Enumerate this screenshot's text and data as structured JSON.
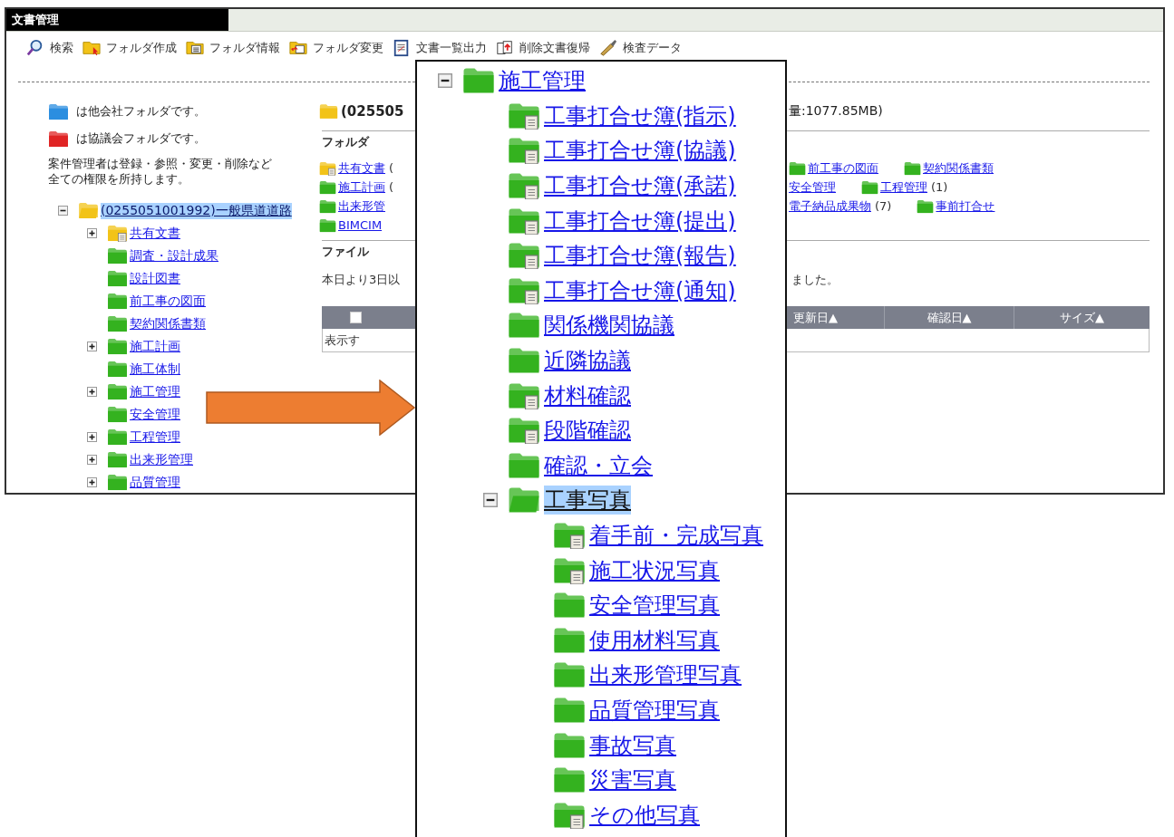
{
  "window": {
    "title": "文書管理"
  },
  "toolbar": [
    {
      "kind": "search",
      "label": "検索"
    },
    {
      "kind": "folder_new",
      "label": "フォルダ作成"
    },
    {
      "kind": "folder_info",
      "label": "フォルダ情報"
    },
    {
      "kind": "folder_change",
      "label": "フォルダ変更"
    },
    {
      "kind": "list_export",
      "label": "文書一覧出力"
    },
    {
      "kind": "restore",
      "label": "削除文書復帰"
    },
    {
      "kind": "inspect",
      "label": "検査データ"
    }
  ],
  "legend": [
    {
      "text": "は他会社フォルダです。",
      "color": "#2b8ee0"
    },
    {
      "text": "は協議会フォルダです。",
      "color": "#e02424"
    }
  ],
  "note": [
    "案件管理者は登録・参照・変更・削除など",
    "全ての権限を所持します。"
  ],
  "tree": {
    "label": "(0255051001992)一般県道道路",
    "kind": "open_yellow",
    "expanded": true,
    "selected": true,
    "children": [
      {
        "label": "共有文書",
        "kind": "shared",
        "expanded": false,
        "selected": false
      },
      {
        "label": "調査・設計成果",
        "kind": "plain",
        "selected": false
      },
      {
        "label": "設計図書",
        "kind": "plain",
        "selected": false
      },
      {
        "label": "前工事の図面",
        "kind": "plain",
        "selected": false
      },
      {
        "label": "契約関係書類",
        "kind": "plain",
        "selected": false
      },
      {
        "label": "施工計画",
        "kind": "plain",
        "expanded": false,
        "selected": false
      },
      {
        "label": "施工体制",
        "kind": "plain",
        "selected": false
      },
      {
        "label": "施工管理",
        "kind": "plain",
        "expanded": false,
        "selected": false
      },
      {
        "label": "安全管理",
        "kind": "plain",
        "selected": false
      },
      {
        "label": "工程管理",
        "kind": "plain",
        "expanded": false,
        "selected": false
      },
      {
        "label": "出来形管理",
        "kind": "plain",
        "expanded": false,
        "selected": false
      },
      {
        "label": "品質管理",
        "kind": "plain",
        "expanded": false,
        "selected": false
      }
    ]
  },
  "content": {
    "heading_left": "(025505",
    "heading_right": "量:1077.85MB)",
    "folders_label": "フォルダ",
    "folders_left": [
      {
        "label": "共有文書",
        "kind": "shared",
        "count": "("
      },
      {
        "label": "施工計画",
        "kind": "plain",
        "count": "("
      },
      {
        "label": "出来形管",
        "kind": "plain"
      },
      {
        "label": "BIMCIM",
        "kind": "plain"
      }
    ],
    "folders_right": [
      [
        {
          "label": "前工事の図面",
          "kind": "plain"
        },
        {
          "label": "契約関係書類",
          "kind": "plain"
        }
      ],
      [
        {
          "label": "安全管理",
          "kind": "none"
        },
        {
          "label": "工程管理",
          "kind": "plain",
          "count": "(1)"
        }
      ],
      [
        {
          "label": "電子納品成果物",
          "kind": "none",
          "count": "(7)"
        },
        {
          "label": "事前打合せ",
          "kind": "plain"
        }
      ]
    ],
    "files_label": "ファイル",
    "notice_left": "本日より3日以",
    "notice_right": "ました。",
    "table": {
      "select_all": {
        "checked": false
      },
      "columns": [
        "更新日▲",
        "確認日▲",
        "サイズ▲"
      ],
      "empty_left": "表示す"
    }
  },
  "detail_tree": {
    "label": "施工管理",
    "kind": "plain",
    "expanded": true,
    "selected": false,
    "children": [
      {
        "label": "工事打合せ簿(指示)",
        "kind": "doc",
        "selected": false
      },
      {
        "label": "工事打合せ簿(協議)",
        "kind": "doc",
        "selected": false
      },
      {
        "label": "工事打合せ簿(承諾)",
        "kind": "doc",
        "selected": false
      },
      {
        "label": "工事打合せ簿(提出)",
        "kind": "doc",
        "selected": false
      },
      {
        "label": "工事打合せ簿(報告)",
        "kind": "doc",
        "selected": false
      },
      {
        "label": "工事打合せ簿(通知)",
        "kind": "doc",
        "selected": false
      },
      {
        "label": "関係機関協議",
        "kind": "plain",
        "selected": false
      },
      {
        "label": "近隣協議",
        "kind": "plain",
        "selected": false
      },
      {
        "label": "材料確認",
        "kind": "doc",
        "selected": false
      },
      {
        "label": "段階確認",
        "kind": "doc",
        "selected": false
      },
      {
        "label": "確認・立会",
        "kind": "plain",
        "selected": false
      },
      {
        "label": "工事写真",
        "kind": "open",
        "expanded": true,
        "selected": true,
        "children": [
          {
            "label": "着手前・完成写真",
            "kind": "doc",
            "selected": false
          },
          {
            "label": "施工状況写真",
            "kind": "doc",
            "selected": false
          },
          {
            "label": "安全管理写真",
            "kind": "plain",
            "selected": false
          },
          {
            "label": "使用材料写真",
            "kind": "plain",
            "selected": false
          },
          {
            "label": "出来形管理写真",
            "kind": "plain",
            "selected": false
          },
          {
            "label": "品質管理写真",
            "kind": "plain",
            "selected": false
          },
          {
            "label": "事故写真",
            "kind": "plain",
            "selected": false
          },
          {
            "label": "災害写真",
            "kind": "plain",
            "selected": false
          },
          {
            "label": "その他写真",
            "kind": "doc",
            "selected": false
          }
        ]
      }
    ]
  }
}
